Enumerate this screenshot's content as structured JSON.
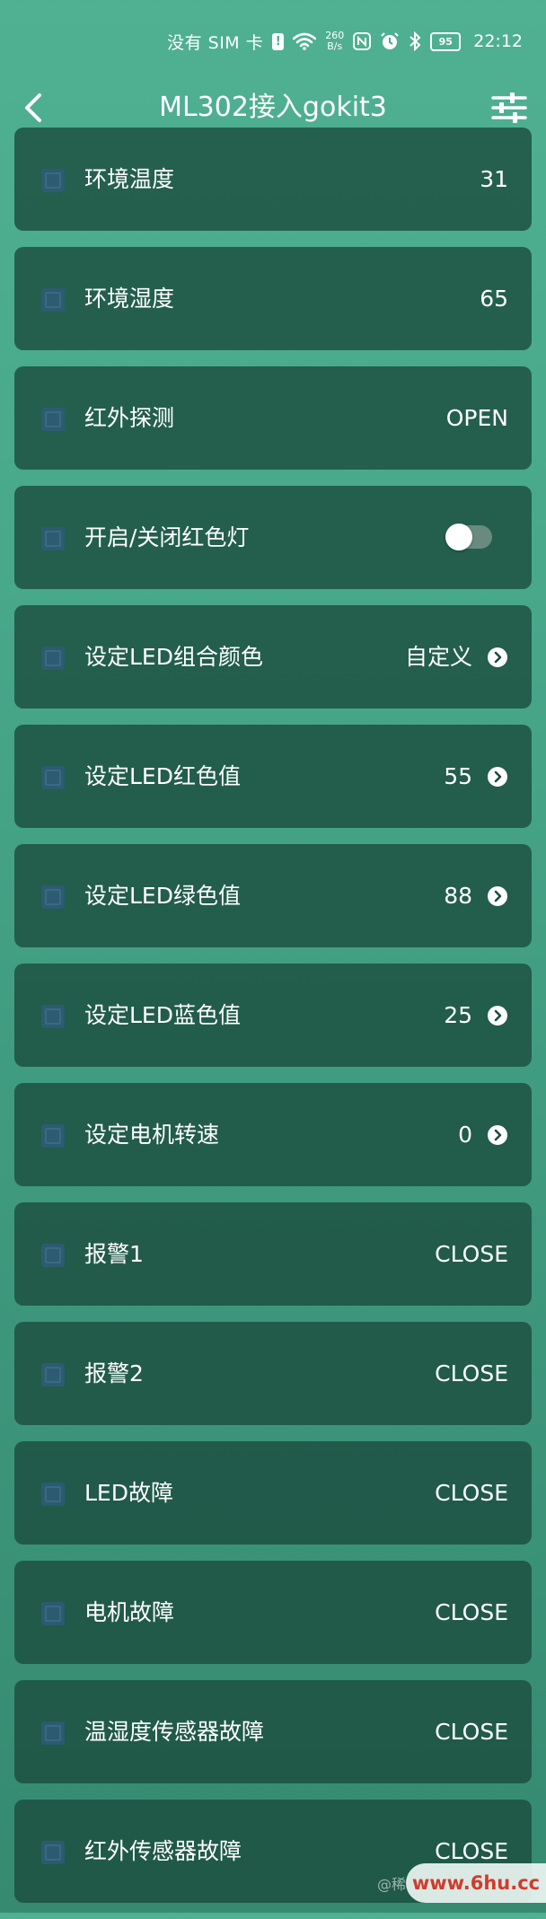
{
  "status_bar": {
    "sim_text": "没有 SIM 卡",
    "net_speed_value": "260",
    "net_speed_unit": "B/s",
    "battery": "95",
    "time": "22:12"
  },
  "header": {
    "title": "ML302接入gokit3",
    "back_icon": "chevron-left-icon",
    "settings_icon": "sliders-icon"
  },
  "rows": [
    {
      "label": "环境温度",
      "value": "31",
      "type": "value"
    },
    {
      "label": "环境湿度",
      "value": "65",
      "type": "value"
    },
    {
      "label": "红外探测",
      "value": "OPEN",
      "type": "value"
    },
    {
      "label": "开启/关闭红色灯",
      "type": "toggle",
      "on": false
    },
    {
      "label": "设定LED组合颜色",
      "value": "自定义",
      "type": "nav"
    },
    {
      "label": "设定LED红色值",
      "value": "55",
      "type": "nav"
    },
    {
      "label": "设定LED绿色值",
      "value": "88",
      "type": "nav"
    },
    {
      "label": "设定LED蓝色值",
      "value": "25",
      "type": "nav"
    },
    {
      "label": "设定电机转速",
      "value": "0",
      "type": "nav"
    },
    {
      "label": "报警1",
      "value": "CLOSE",
      "type": "value"
    },
    {
      "label": "报警2",
      "value": "CLOSE",
      "type": "value"
    },
    {
      "label": "LED故障",
      "value": "CLOSE",
      "type": "value"
    },
    {
      "label": "电机故障",
      "value": "CLOSE",
      "type": "value"
    },
    {
      "label": "温湿度传感器故障",
      "value": "CLOSE",
      "type": "value"
    },
    {
      "label": "红外传感器故障",
      "value": "CLOSE",
      "type": "value"
    }
  ],
  "watermark": {
    "prefix": "@稀",
    "site": "www.6hu.cc"
  },
  "colors": {
    "accent": "#4fb191",
    "card": "#1c4e40",
    "watermark_text": "#d23b2b"
  }
}
